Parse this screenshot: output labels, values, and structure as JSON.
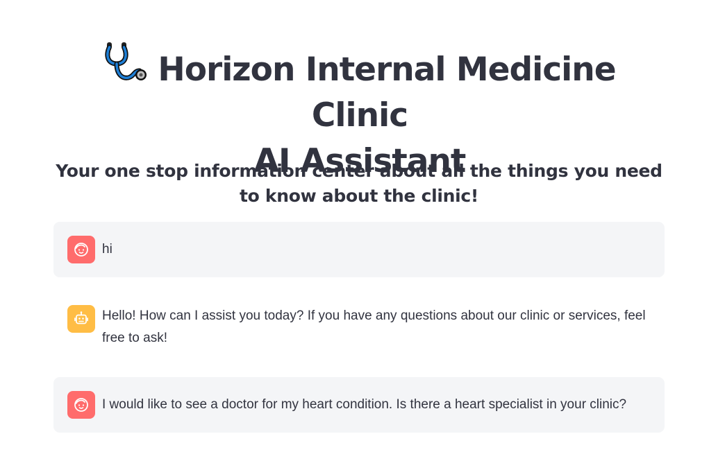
{
  "header": {
    "title_line1": "Horizon Internal Medicine Clinic",
    "title_line2": "AI Assistant",
    "icon": "stethoscope-icon",
    "subtitle": "Your one stop information center about all the things you need to know about the clinic!"
  },
  "chat": {
    "messages": [
      {
        "role": "user",
        "avatar_icon": "user-face-icon",
        "text": "hi"
      },
      {
        "role": "assistant",
        "avatar_icon": "robot-icon",
        "text": "Hello! How can I assist you today? If you have any questions about our clinic or services, feel free to ask!"
      },
      {
        "role": "user",
        "avatar_icon": "user-face-icon",
        "text": "I would like to see a doctor for my heart condition. Is there a heart specialist in your clinic?"
      }
    ]
  },
  "colors": {
    "text": "#31333f",
    "user_avatar_bg": "#ff6c6c",
    "assistant_avatar_bg": "#ffbd45",
    "user_message_bg": "#f4f5f7",
    "stethoscope_blue": "#1e7fd6"
  }
}
